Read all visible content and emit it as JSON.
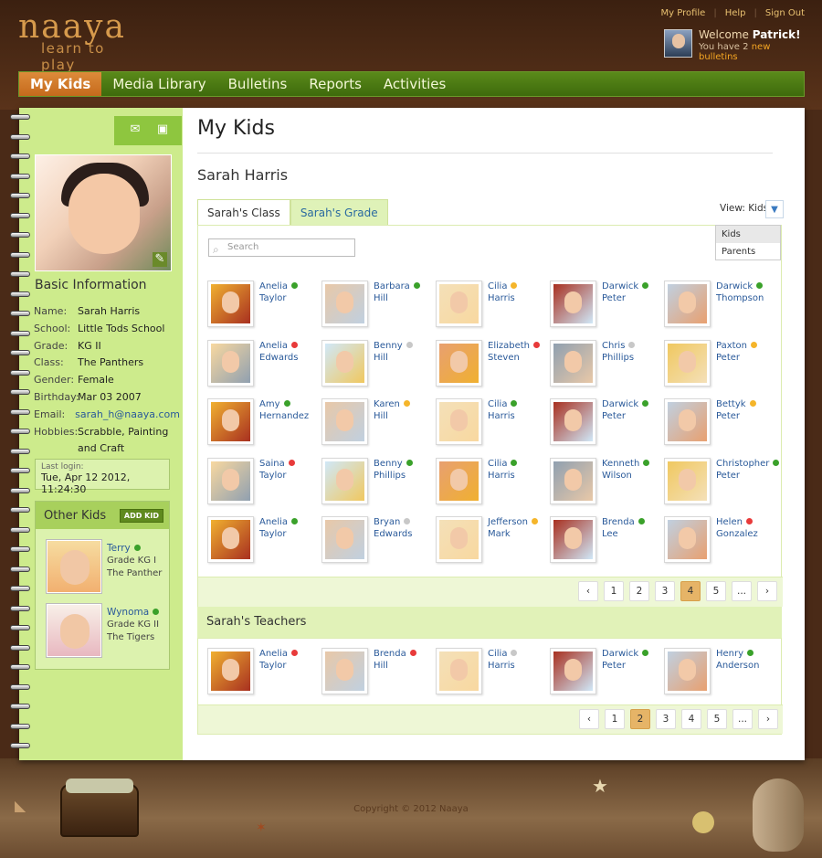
{
  "brand": {
    "logo_main": "naaya",
    "logo_tagline": "learn to play"
  },
  "top_links": [
    "My Profile",
    "Help",
    "Sign Out"
  ],
  "welcome": {
    "greeting": "Welcome",
    "user": "Patrick!",
    "bulletins_prefix": "You have",
    "bulletins_count": "2",
    "bulletins_suffix": "new bulletins"
  },
  "nav": [
    "My Kids",
    "Media Library",
    "Bulletins",
    "Reports",
    "Activities"
  ],
  "nav_active": "My Kids",
  "sidebar": {
    "basic_info_title": "Basic Information",
    "fields": [
      {
        "k": "Name:",
        "v": "Sarah Harris"
      },
      {
        "k": "School:",
        "v": "Little Tods School"
      },
      {
        "k": "Grade:",
        "v": "KG II"
      },
      {
        "k": "Class:",
        "v": "The Panthers"
      },
      {
        "k": "Gender:",
        "v": "Female"
      },
      {
        "k": "Birthday:",
        "v": "Mar 03 2007"
      },
      {
        "k": "Email:",
        "v": "sarah_h@naaya.com"
      },
      {
        "k": "Hobbies:",
        "v": "Scrabble, Painting and Craft"
      }
    ],
    "last_login_label": "Last login:",
    "last_login_value": "Tue, Apr 12 2012, 11:24:30",
    "other_kids_title": "Other Kids",
    "add_kid_label": "ADD KID",
    "other_kids": [
      {
        "name": "Terry",
        "grade": "Grade KG I",
        "class": "The Panther",
        "status": "online"
      },
      {
        "name": "Wynoma",
        "grade": "Grade KG II",
        "class": "The Tigers",
        "status": "online"
      }
    ]
  },
  "main": {
    "title": "My  Kids",
    "kid_name": "Sarah Harris",
    "tabs": [
      "Sarah's Class",
      "Sarah's Grade"
    ],
    "view_label": "View: Kids",
    "view_options": [
      "Kids",
      "Parents"
    ],
    "search_placeholder": "Search",
    "classmates": [
      {
        "first": "Anelia",
        "last": "Taylor",
        "status": "online"
      },
      {
        "first": "Barbara",
        "last": "Hill",
        "status": "online"
      },
      {
        "first": "Cilia",
        "last": "Harris",
        "status": "away"
      },
      {
        "first": "Darwick",
        "last": "Peter",
        "status": "online"
      },
      {
        "first": "Darwick",
        "last": "Thompson",
        "status": "online"
      },
      {
        "first": "Anelia",
        "last": "Edwards",
        "status": "busy"
      },
      {
        "first": "Benny",
        "last": "Hill",
        "status": "offline"
      },
      {
        "first": "Elizabeth",
        "last": "Steven",
        "status": "busy"
      },
      {
        "first": "Chris",
        "last": "Phillips",
        "status": "offline"
      },
      {
        "first": "Paxton",
        "last": "Peter",
        "status": "away"
      },
      {
        "first": "Amy",
        "last": "Hernandez",
        "status": "online"
      },
      {
        "first": "Karen",
        "last": "Hill",
        "status": "away"
      },
      {
        "first": "Cilia",
        "last": "Harris",
        "status": "online"
      },
      {
        "first": "Darwick",
        "last": "Peter",
        "status": "online"
      },
      {
        "first": "Bettyk",
        "last": "Peter",
        "status": "away"
      },
      {
        "first": "Saina",
        "last": "Taylor",
        "status": "busy"
      },
      {
        "first": "Benny",
        "last": "Phillips",
        "status": "online"
      },
      {
        "first": "Cilia",
        "last": "Harris",
        "status": "online"
      },
      {
        "first": "Kenneth",
        "last": "Wilson",
        "status": "online"
      },
      {
        "first": "Christopher",
        "last": "Peter",
        "status": "online"
      },
      {
        "first": "Anelia",
        "last": "Taylor",
        "status": "online"
      },
      {
        "first": "Bryan",
        "last": "Edwards",
        "status": "offline"
      },
      {
        "first": "Jefferson",
        "last": "Mark",
        "status": "away"
      },
      {
        "first": "Brenda",
        "last": "Lee",
        "status": "online"
      },
      {
        "first": "Helen",
        "last": "Gonzalez",
        "status": "busy"
      }
    ],
    "class_pager": {
      "pages": [
        "1",
        "2",
        "3",
        "4",
        "5",
        "..."
      ],
      "active": "4"
    },
    "teachers_title": "Sarah's Teachers",
    "teachers": [
      {
        "first": "Anelia",
        "last": "Taylor",
        "status": "busy"
      },
      {
        "first": "Brenda",
        "last": "Hill",
        "status": "busy"
      },
      {
        "first": "Cilia",
        "last": "Harris",
        "status": "offline"
      },
      {
        "first": "Darwick",
        "last": "Peter",
        "status": "online"
      },
      {
        "first": "Henry",
        "last": "Anderson",
        "status": "online"
      }
    ],
    "teacher_pager": {
      "pages": [
        "1",
        "2",
        "3",
        "4",
        "5",
        "..."
      ],
      "active": "2"
    }
  },
  "footer": {
    "copyright": "Copyright © 2012 Naaya"
  },
  "status_colors": {
    "online": "#3aa12a",
    "away": "#f5b52a",
    "busy": "#e83a3a",
    "offline": "#c8c8c8"
  },
  "colors": {
    "nav_green": "#4a7a14",
    "nav_active": "#d37b2c",
    "sidebar_green": "#cdeb8c",
    "link_blue": "#2a5a9a"
  }
}
